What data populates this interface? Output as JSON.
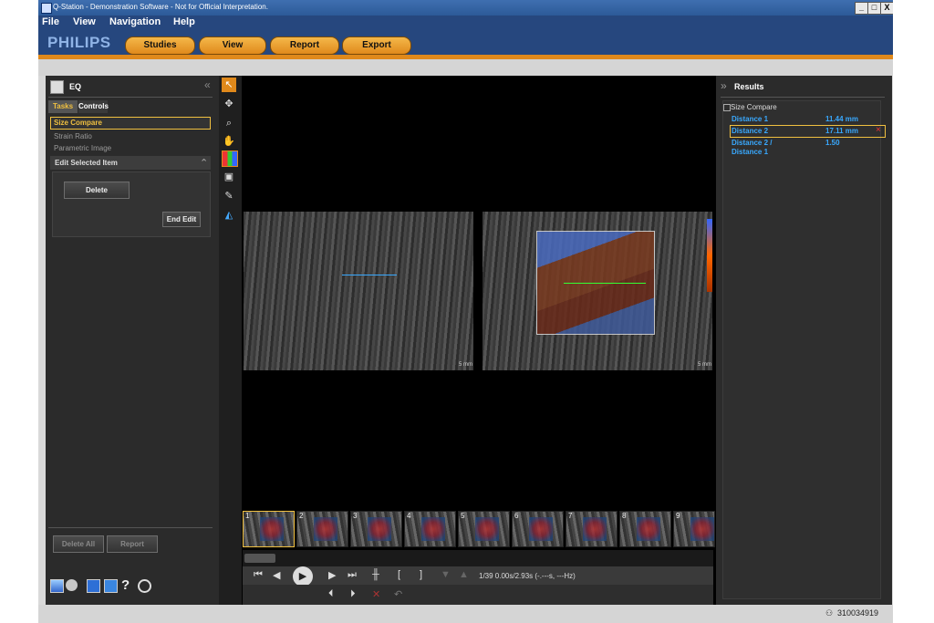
{
  "window": {
    "title": "Q-Station - Demonstration Software - Not for Official Interpretation.",
    "controls": [
      "_",
      "□",
      "X"
    ]
  },
  "menu": [
    "File",
    "View",
    "Navigation",
    "Help"
  ],
  "brand": "PHILIPS",
  "nav_tabs": [
    "Studies",
    "View",
    "Report",
    "Export"
  ],
  "left_panel": {
    "header": "EQ",
    "collapse_glyph": "«",
    "tabs": [
      "Tasks",
      "Controls"
    ],
    "tasks": [
      "Size Compare",
      "Strain Ratio",
      "Parametric Image"
    ],
    "edit_section": "Edit Selected Item",
    "edit_glyph": "⌃",
    "delete_label": "Delete",
    "end_edit_label": "End Edit",
    "delete_all_label": "Delete All",
    "report_label": "Report",
    "bottom_icons": [
      "grid-icon",
      "settings-icon",
      "save-icon",
      "export-icon",
      "help-icon",
      "qlab-icon"
    ],
    "help_glyph": "?"
  },
  "viewer": {
    "scale_left": "5 mm",
    "scale_right": "5 mm",
    "thumbnails": [
      "1",
      "2",
      "3",
      "4",
      "5",
      "6",
      "7",
      "8",
      "9"
    ],
    "frame_info": "1/39  0.00s/2.93s (-.---s, ---Hz)"
  },
  "results": {
    "header": "Results",
    "expand_glyph": "»",
    "section": "Size Compare",
    "rows": [
      {
        "label": "Distance 1",
        "value": "11.44 mm"
      },
      {
        "label": "Distance 2",
        "value": "17.11 mm"
      },
      {
        "label": "Distance 2 /",
        "label2": "Distance 1",
        "value": "1.50"
      }
    ],
    "remove_glyph": "×"
  },
  "status": {
    "user_icon": "user-icon",
    "id": "310034919"
  },
  "colors": {
    "accent_orange": "#e0891b",
    "brand_blue": "#26477e",
    "result_blue": "#39a9ff",
    "selection_yellow": "#f0c040"
  }
}
